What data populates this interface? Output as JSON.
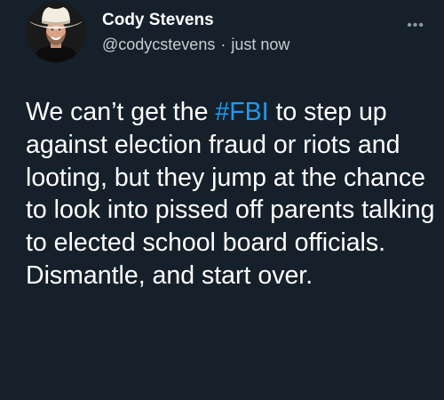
{
  "author": {
    "display_name": "Cody Stevens",
    "handle": "@codycstevens",
    "separator": "·",
    "time": "just now",
    "avatar_icon": "cowboy-hat-avatar"
  },
  "menu_icon": "ellipsis-icon",
  "tweet": {
    "text_before": "We can’t get the ",
    "hashtag": "#FBI",
    "text_after": " to step up against election fraud or riots and looting, but they jump at the chance to look into pissed off parents talking to elected school board officials. Dismantle, and start over."
  },
  "colors": {
    "background": "#15202b",
    "text": "#ffffff",
    "secondary_text": "#c7cdd2",
    "hashtag": "#1d9bf0"
  }
}
